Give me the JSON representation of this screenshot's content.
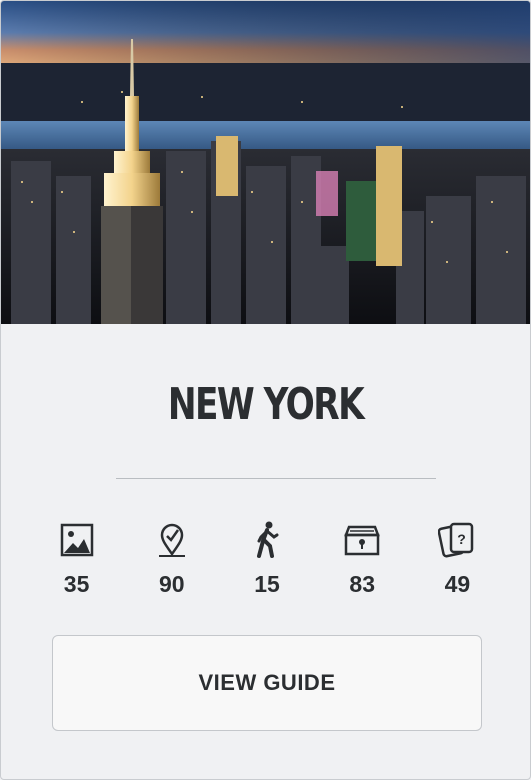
{
  "city": {
    "name": "NEW YORK"
  },
  "stats": [
    {
      "icon": "photo-icon",
      "value": "35"
    },
    {
      "icon": "location-pin-icon",
      "value": "90"
    },
    {
      "icon": "walking-person-icon",
      "value": "15"
    },
    {
      "icon": "treasure-chest-icon",
      "value": "83"
    },
    {
      "icon": "question-cards-icon",
      "value": "49"
    }
  ],
  "button": {
    "label": "VIEW GUIDE"
  },
  "colors": {
    "background": "#f0f1f3",
    "text": "#2b2e31",
    "divider": "#b9bdc1"
  }
}
